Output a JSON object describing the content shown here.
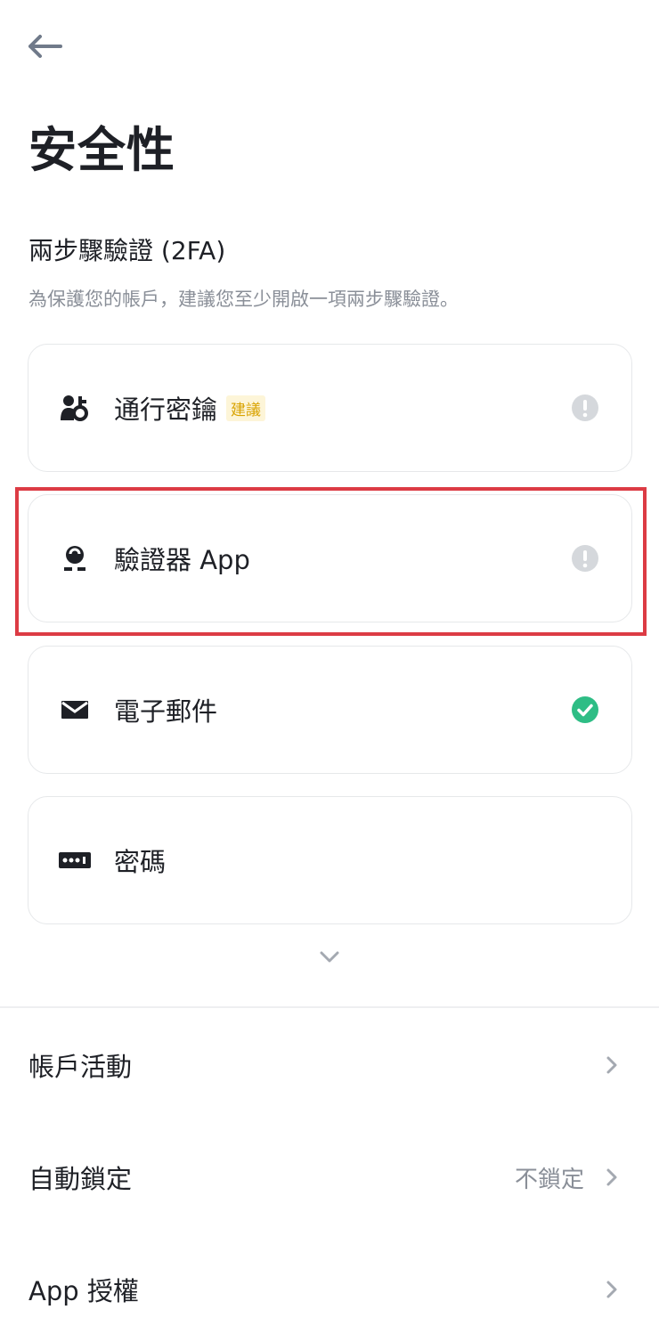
{
  "header": {
    "title": "安全性"
  },
  "twofa": {
    "title": "兩步驟驗證 (2FA)",
    "description": "為保護您的帳戶，建議您至少開啟一項兩步驟驗證。",
    "items": [
      {
        "label": "通行密鑰",
        "badge": "建議",
        "icon": "passkey-icon",
        "status": "warning"
      },
      {
        "label": "驗證器 App",
        "icon": "authenticator-icon",
        "status": "warning"
      },
      {
        "label": "電子郵件",
        "icon": "email-icon",
        "status": "verified"
      },
      {
        "label": "密碼",
        "icon": "password-icon",
        "status": "none"
      }
    ]
  },
  "settings": [
    {
      "label": "帳戶活動",
      "value": ""
    },
    {
      "label": "自動鎖定",
      "value": "不鎖定"
    },
    {
      "label": "App 授權",
      "value": ""
    }
  ],
  "colors": {
    "text_primary": "#1e2026",
    "text_secondary": "#8a8f98",
    "border": "#e6e8ea",
    "warning_icon": "#d5d8dc",
    "verified_icon": "#2ebd85",
    "badge_bg": "#fdf5d8",
    "badge_text": "#d9a300",
    "highlight": "#dc3b44"
  }
}
